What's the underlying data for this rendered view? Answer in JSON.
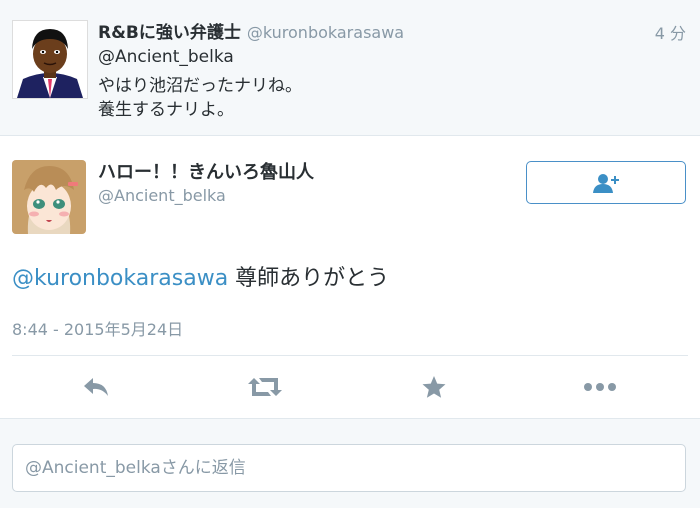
{
  "parent_tweet": {
    "display_name": "R&Bに強い弁護士",
    "handle": "@kuronbokarasawa",
    "time": "4 分",
    "lines": [
      "@Ancient_belka",
      "やはり池沼だったナリね。",
      "養生するナリよ。"
    ]
  },
  "main_tweet": {
    "display_name": "ハロー！！きんいろ魯山人",
    "handle": "@Ancient_belka",
    "follow_icon": "add-user-icon",
    "mention": "@kuronbokarasawa",
    "text": " 尊師ありがとう",
    "date": "8:44 - 2015年5月24日",
    "actions": [
      "reply-icon",
      "retweet-icon",
      "favorite-icon",
      "more-icon"
    ]
  },
  "reply": {
    "placeholder": "@Ancient_belkaさんに返信"
  },
  "colors": {
    "link": "#3b8fc5",
    "muted": "#8899a6",
    "icon": "#8899a6",
    "follow_border": "#4a90c8"
  }
}
